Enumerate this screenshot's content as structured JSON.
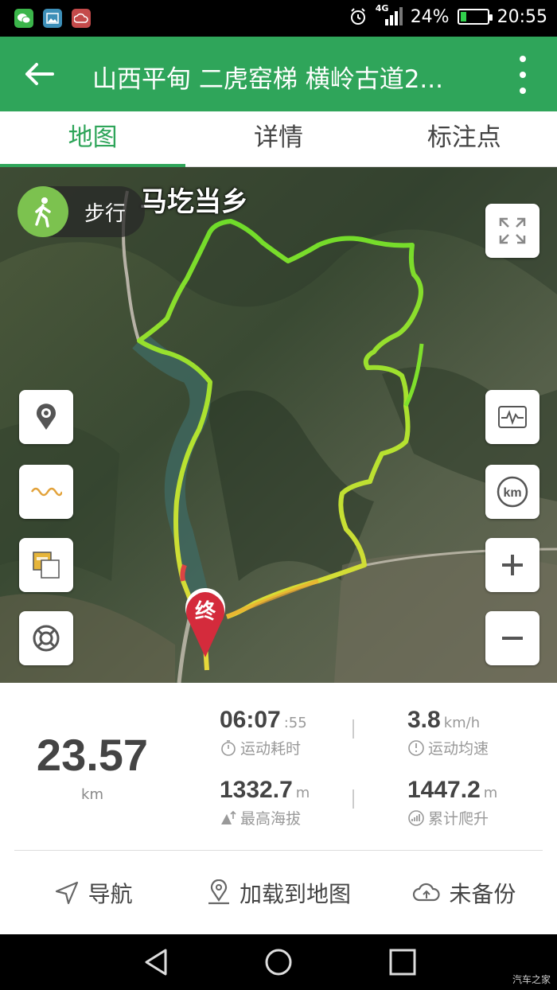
{
  "status_bar": {
    "network": "4G",
    "battery": "24%",
    "battery_level": 0.24,
    "time": "20:55",
    "app_icons": [
      "wechat-icon",
      "gallery-icon",
      "cloud-sync-icon"
    ]
  },
  "app_bar": {
    "title": "山西平甸 二虎窑梯 横岭古道2..."
  },
  "tabs": [
    {
      "label": "地图",
      "active": true
    },
    {
      "label": "详情",
      "active": false
    },
    {
      "label": "标注点",
      "active": false
    }
  ],
  "map": {
    "place_label": "马圪当乡",
    "mode_label": "步行",
    "end_marker_label": "终",
    "left_controls": [
      "location-pin-icon",
      "track-line-icon",
      "layers-icon",
      "lifebuoy-icon"
    ],
    "right_controls": [
      "fullscreen-icon",
      "chart-icon",
      "km-icon",
      "zoom-in-icon",
      "zoom-out-icon"
    ],
    "km_text": "km"
  },
  "stats": {
    "distance": "23.57",
    "distance_unit": "km",
    "duration": "06:07",
    "duration_seconds": ":55",
    "duration_label": "运动耗时",
    "avg_speed": "3.8",
    "avg_speed_unit": "km/h",
    "avg_speed_label": "运动均速",
    "max_altitude": "1332.7",
    "max_altitude_unit": "m",
    "max_altitude_label": "最高海拔",
    "total_ascent": "1447.2",
    "total_ascent_unit": "m",
    "total_ascent_label": "累计爬升"
  },
  "actions": [
    {
      "label": "导航",
      "icon": "navigation-arrow-icon"
    },
    {
      "label": "加载到地图",
      "icon": "map-pin-icon"
    },
    {
      "label": "未备份",
      "icon": "cloud-upload-icon"
    }
  ],
  "watermark": "汽车之家",
  "colors": {
    "brand_green": "#2fa55a",
    "track_green": "#6fdc2a",
    "track_yellow": "#e8d93a",
    "end_marker": "#d42b3c"
  }
}
